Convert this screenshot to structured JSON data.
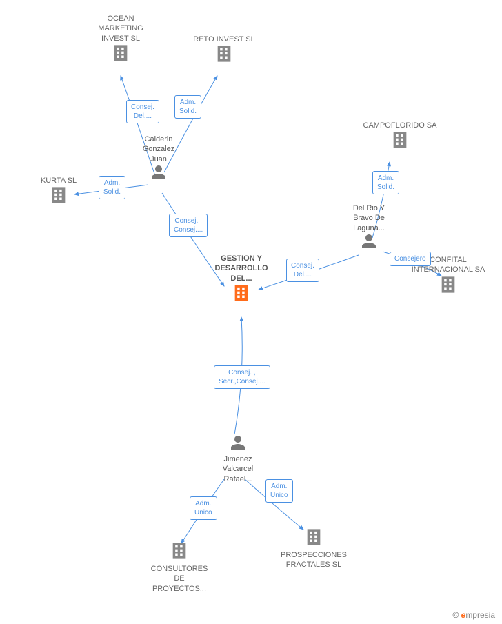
{
  "footer": {
    "copyright_symbol": "©",
    "brand_e": "e",
    "brand_rest": "mpresia"
  },
  "nodes": {
    "ocean": {
      "label": "OCEAN\nMARKETING\nINVEST SL"
    },
    "reto": {
      "label": "RETO INVEST SL"
    },
    "campoflorido": {
      "label": "CAMPOFLORIDO SA"
    },
    "kurta": {
      "label": "KURTA SL"
    },
    "confital": {
      "label": "CONFITAL\nINTERNACIONAL SA"
    },
    "prospecciones": {
      "label": "PROSPECCIONES\nFRACTALES SL"
    },
    "consultores": {
      "label": "CONSULTORES\nDE\nPROYECTOS..."
    },
    "gestion": {
      "label": "GESTION Y\nDESARROLLO\nDEL..."
    },
    "calderin": {
      "label": "Calderin\nGonzalez\nJuan"
    },
    "delrio": {
      "label": "Del Rio Y\nBravo De\nLaguna..."
    },
    "jimenez": {
      "label": "Jimenez\nValcarcel\nRafael..."
    }
  },
  "edges": {
    "calderin_ocean": {
      "label": "Consej.\nDel...."
    },
    "calderin_reto": {
      "label": "Adm.\nSolid."
    },
    "calderin_kurta": {
      "label": "Adm.\nSolid."
    },
    "calderin_gestion": {
      "label": "Consej. ,\nConsej...."
    },
    "delrio_campoflorido": {
      "label": "Adm.\nSolid."
    },
    "delrio_gestion": {
      "label": "Consej.\nDel...."
    },
    "delrio_confital": {
      "label": "Consejero"
    },
    "jimenez_gestion": {
      "label": "Consej. ,\nSecr.,Consej...."
    },
    "jimenez_consultores": {
      "label": "Adm.\nUnico"
    },
    "jimenez_prospecciones": {
      "label": "Adm.\nUnico"
    }
  }
}
